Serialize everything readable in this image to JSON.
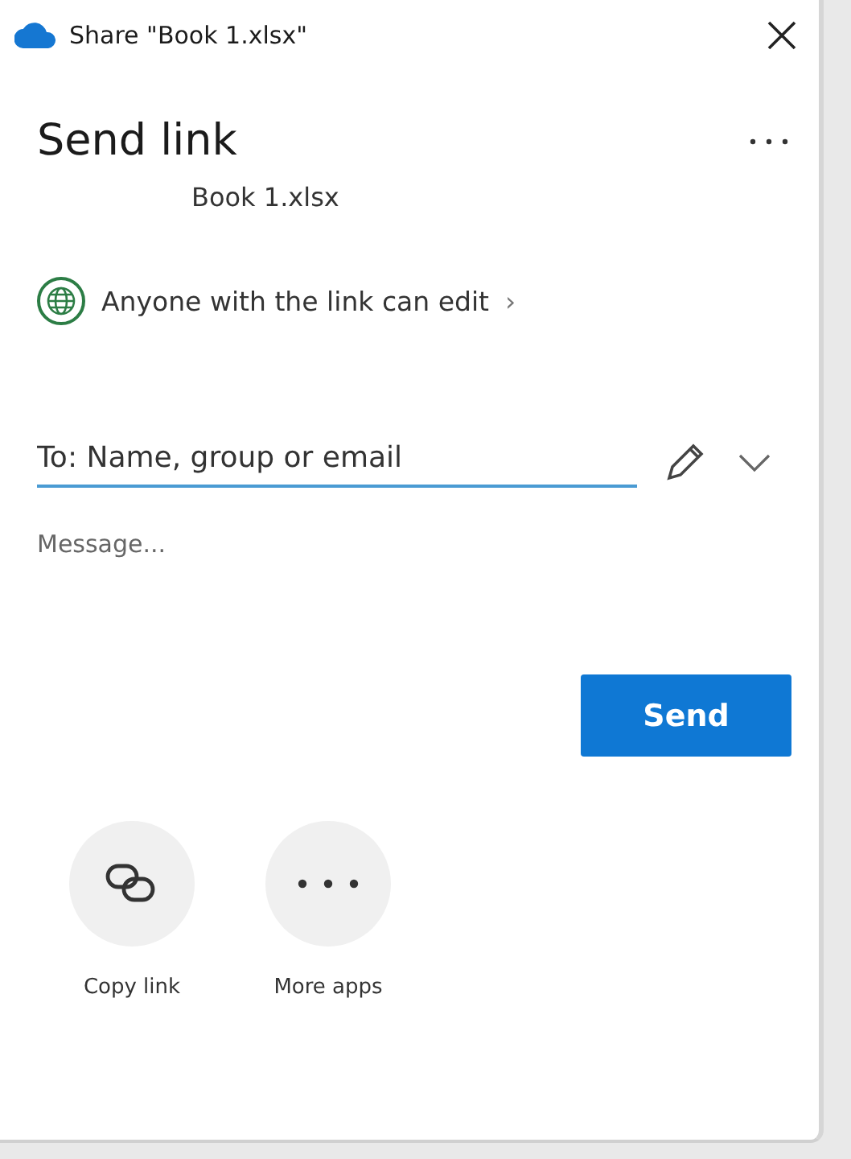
{
  "window": {
    "title": "Share \"Book 1.xlsx\""
  },
  "heading": "Send link",
  "file_name": "Book 1.xlsx",
  "permission": {
    "label": "Anyone with the link can edit",
    "chevron": "›"
  },
  "recipient": {
    "placeholder": "To: Name, group or email"
  },
  "message": {
    "placeholder": "Message..."
  },
  "send_button": "Send",
  "actions": [
    {
      "kind": "copy",
      "label": "Copy link"
    },
    {
      "kind": "more",
      "label": "More apps"
    }
  ]
}
